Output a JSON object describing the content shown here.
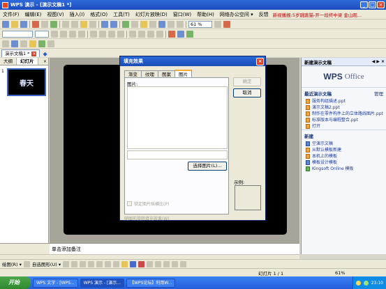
{
  "window": {
    "title": "WPS 演示 - [演示文稿1 *]"
  },
  "menu": {
    "items": [
      "文件(F)",
      "编辑(E)",
      "视图(V)",
      "插入(I)",
      "格式(O)",
      "工具(T)",
      "幻灯片放映(D)",
      "窗口(W)",
      "帮助(H)"
    ],
    "share": "网络办公空间 ▾",
    "qa": "反馈",
    "news": "新视播报:5岁跳跳猫-开一段终中梁 金山观..."
  },
  "toolbar": {
    "zoom": "61 %"
  },
  "doc_tabs": [
    {
      "label": "演示文稿1 *"
    }
  ],
  "left_pane": {
    "tabs": [
      "大纲",
      "幻灯片"
    ],
    "slide_number": "1",
    "thumb_text": "春天"
  },
  "notes": {
    "placeholder": "单击添加备注"
  },
  "task_pane": {
    "title": "新建演示文稿",
    "logo_wps": "WPS",
    "logo_office": "Office",
    "sections": [
      {
        "title": "最近演示文稿",
        "action": "管理",
        "items": [
          "服务构组描述.ppt",
          "演示文稿2.ppt",
          "制作在零件构件上的立体路线图片.ppt",
          "标准版本与编程整合.ppt",
          "打开"
        ]
      },
      {
        "title": "新建",
        "items": [
          "空演示文稿",
          "从默认模板新建",
          "本机上的模板",
          "模板设计模板",
          "Kingsoft Online 模板"
        ]
      }
    ]
  },
  "dialog": {
    "title": "填充效果",
    "tabs": [
      "渐变",
      "纹理",
      "图案",
      "图片"
    ],
    "active_tab": 3,
    "panel_label": "图片:",
    "select_button": "选择图片(L)...",
    "lock_checkbox": "锁定图片纵横比(P)",
    "rotate_hint": "随图形旋转填充效果(W)",
    "ok": "确定",
    "cancel": "取消",
    "sample": "示例:"
  },
  "drawbar": {
    "label": "绘图(R) ▾",
    "autoshape": "自选图形(U) ▾"
  },
  "status": {
    "slide": "幻灯片 1 / 1",
    "zoom": "61%"
  },
  "taskbar": {
    "start": "开始",
    "tasks": [
      "WPS 文字 - [WPS...",
      "WPS 演示 - [演示...",
      "【WPS论坛】利用W..."
    ],
    "clock": "23:10"
  }
}
